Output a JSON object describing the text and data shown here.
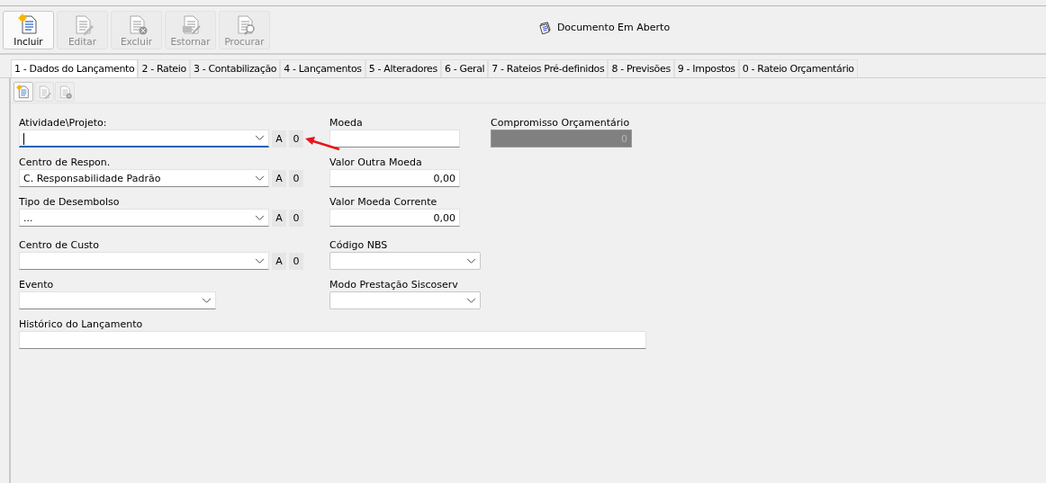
{
  "toolbar": [
    {
      "label": "Incluir",
      "disabled": false
    },
    {
      "label": "Editar",
      "disabled": true
    },
    {
      "label": "Excluir",
      "disabled": true
    },
    {
      "label": "Estornar",
      "disabled": true
    },
    {
      "label": "Procurar",
      "disabled": true
    }
  ],
  "status": {
    "title": "Documento Em Aberto"
  },
  "tabs": [
    {
      "label": "1 - Dados do Lançamento",
      "selected": true
    },
    {
      "label": "2 - Rateio",
      "selected": false
    },
    {
      "label": "3 - Contabilização",
      "selected": false
    },
    {
      "label": "4 - Lançamentos",
      "selected": false
    },
    {
      "label": "5 - Alteradores",
      "selected": false
    },
    {
      "label": "6 - Geral",
      "selected": false
    },
    {
      "label": "7 - Rateios Pré-definidos",
      "selected": false
    },
    {
      "label": "8 - Previsões",
      "selected": false
    },
    {
      "label": "9 - Impostos",
      "selected": false
    },
    {
      "label": "0 - Rateio Orçamentário",
      "selected": false
    }
  ],
  "sub_toolbar": [
    {
      "disabled": false
    },
    {
      "disabled": true
    },
    {
      "disabled": true
    }
  ],
  "rows": [
    {
      "fields": [
        {
          "label": "Atividade\\Projeto:",
          "kind": "combo",
          "focused": true,
          "extras": [
            "A",
            "0"
          ]
        },
        {
          "label": "Moeda",
          "kind": "text"
        },
        {
          "label": "Compromisso Orçamentário",
          "kind": "disabled",
          "value": "0"
        }
      ]
    },
    {
      "fields": [
        {
          "label": "Centro de Respon.",
          "kind": "combo",
          "value": "C. Responsabilidade Padrão",
          "focused": false,
          "extras": [
            "A",
            "0"
          ]
        },
        {
          "label": "Valor Outra Moeda",
          "kind": "number",
          "value": "0,00"
        }
      ]
    },
    {
      "fields": [
        {
          "label": "Tipo de Desembolso",
          "kind": "combo",
          "value": "...",
          "focused": false,
          "extras": [
            "A",
            "0"
          ]
        },
        {
          "label": "Valor Moeda Corrente",
          "kind": "number",
          "value": "0,00"
        }
      ]
    },
    {
      "fields": [
        {
          "label": "Centro de Custo",
          "kind": "combo",
          "focused": false,
          "extras": [
            "A",
            "0"
          ]
        },
        {
          "label": "Código NBS",
          "kind": "combo",
          "focused": false
        }
      ]
    },
    {
      "fields": [
        {
          "label": "Evento",
          "kind": "combo",
          "focused": false
        },
        {
          "label": "Modo Prestação Siscoserv",
          "kind": "combo",
          "focused": false
        }
      ]
    },
    {
      "fields": [
        {
          "label": "Histórico do Lançamento",
          "kind": "text"
        }
      ]
    }
  ]
}
